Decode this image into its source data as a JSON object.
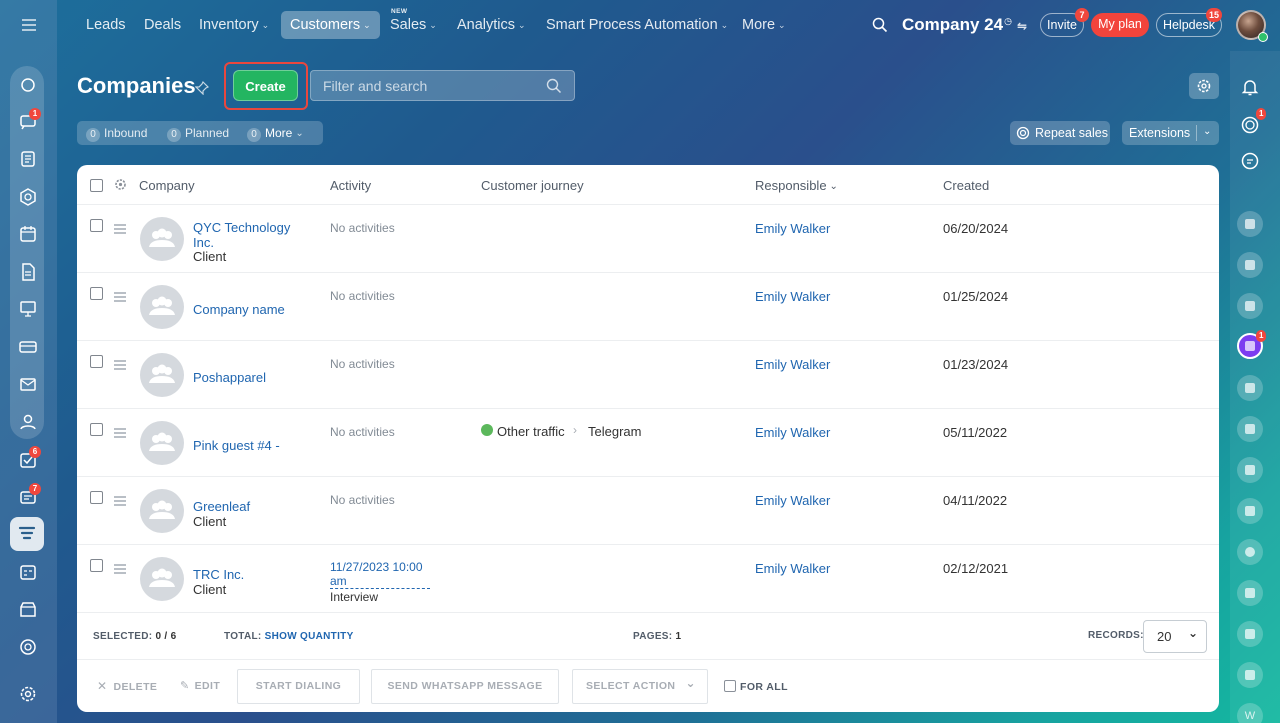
{
  "nav": {
    "items": [
      "Leads",
      "Deals",
      "Inventory",
      "Customers",
      "Sales",
      "Analytics",
      "Smart Process Automation",
      "More"
    ],
    "new_tag": "NEW",
    "company": "Company 24",
    "invite": "Invite",
    "invite_count": "7",
    "my_plan": "My plan",
    "helpdesk": "Helpdesk",
    "helpdesk_count": "15"
  },
  "leftbar": {
    "badges": {
      "chat": "1",
      "tasks": "6",
      "feed": "7"
    }
  },
  "rightbar": {
    "notif_badge": "1",
    "purple_badge": "1",
    "last_letter": "W"
  },
  "page": {
    "title": "Companies",
    "create_label": "Create",
    "search_placeholder": "Filter and search",
    "counters": [
      {
        "count": "0",
        "label": "Inbound"
      },
      {
        "count": "0",
        "label": "Planned"
      },
      {
        "count": "0",
        "label": "More"
      }
    ],
    "repeat_sales": "Repeat sales",
    "extensions": "Extensions"
  },
  "table": {
    "columns": {
      "company": "Company",
      "activity": "Activity",
      "journey": "Customer journey",
      "responsible": "Responsible",
      "created": "Created"
    },
    "rows": [
      {
        "name": "QYC Technology Inc.",
        "type": "Client",
        "activity": "No activities",
        "journey_source": "",
        "journey_target": "",
        "responsible": "Emily Walker",
        "created": "06/20/2024"
      },
      {
        "name": "Company name",
        "type": "",
        "activity": "No activities",
        "journey_source": "",
        "journey_target": "",
        "responsible": "Emily Walker",
        "created": "01/25/2024"
      },
      {
        "name": "Poshapparel",
        "type": "",
        "activity": "No activities",
        "journey_source": "",
        "journey_target": "",
        "responsible": "Emily Walker",
        "created": "01/23/2024"
      },
      {
        "name": "Pink guest #4 -",
        "type": "",
        "activity": "No activities",
        "journey_source": "Other traffic",
        "journey_target": "Telegram",
        "responsible": "Emily Walker",
        "created": "05/11/2022"
      },
      {
        "name": "Greenleaf",
        "type": "Client",
        "activity": "No activities",
        "journey_source": "",
        "journey_target": "",
        "responsible": "Emily Walker",
        "created": "04/11/2022"
      },
      {
        "name": "TRC Inc.",
        "type": "Client",
        "activity": "",
        "activity_date": "11/27/2023 10:00 am",
        "activity_title": "Interview",
        "journey_source": "",
        "journey_target": "",
        "responsible": "Emily Walker",
        "created": "02/12/2021"
      }
    ]
  },
  "footer": {
    "selected_label": "SELECTED:",
    "selected_value": "0 / 6",
    "total_label": "TOTAL:",
    "total_link": "SHOW QUANTITY",
    "pages_label": "PAGES:",
    "pages_value": "1",
    "records_label": "RECORDS:",
    "records_value": "20"
  },
  "actions": {
    "delete": "DELETE",
    "edit": "EDIT",
    "start_dialing": "START DIALING",
    "whatsapp": "SEND WHATSAPP MESSAGE",
    "select_action": "SELECT ACTION",
    "for_all": "FOR ALL"
  }
}
